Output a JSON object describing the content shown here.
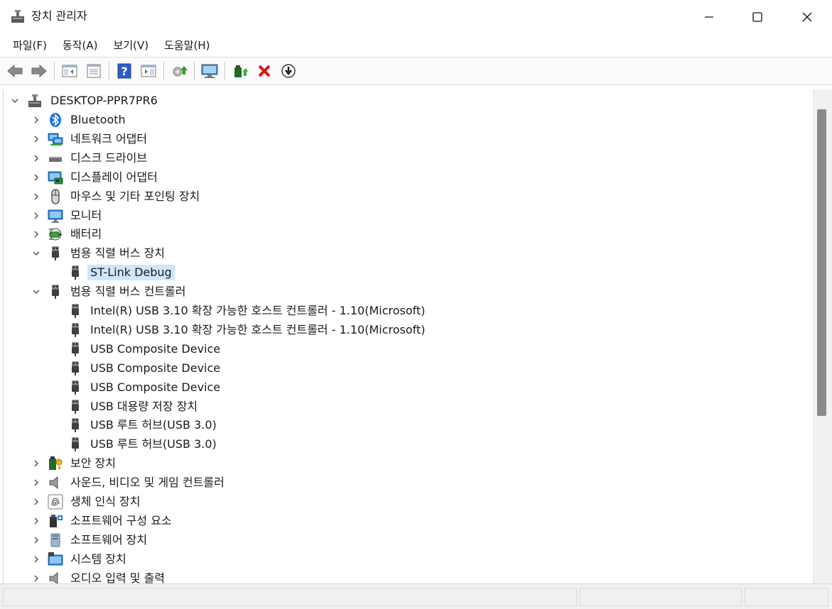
{
  "window": {
    "title": "장치 관리자",
    "minimize_icon": "minimize-icon",
    "maximize_icon": "maximize-icon",
    "close_icon": "close-icon"
  },
  "menu": [
    "파일(F)",
    "동작(A)",
    "보기(V)",
    "도움말(H)"
  ],
  "toolbar": {
    "buttons": [
      "back-arrow-icon",
      "forward-arrow-icon",
      "show-hide-console-tree-icon",
      "properties-icon",
      "help-icon",
      "action-pane-icon",
      "update-driver-icon",
      "scan-hardware-icon",
      "enable-device-icon",
      "uninstall-device-icon",
      "disable-device-icon"
    ]
  },
  "tree": {
    "root": "DESKTOP-PPR7PR6",
    "rows": [
      {
        "label": "Bluetooth",
        "icon": "bluetooth-icon",
        "level": 1,
        "expanded": false
      },
      {
        "label": "네트워크 어댑터",
        "icon": "network-adapter-icon",
        "level": 1,
        "expanded": false
      },
      {
        "label": "디스크 드라이브",
        "icon": "disk-drive-icon",
        "level": 1,
        "expanded": false
      },
      {
        "label": "디스플레이 어댑터",
        "icon": "display-adapter-icon",
        "level": 1,
        "expanded": false
      },
      {
        "label": "마우스 및 기타 포인팅 장치",
        "icon": "mouse-icon",
        "level": 1,
        "expanded": false
      },
      {
        "label": "모니터",
        "icon": "monitor-icon",
        "level": 1,
        "expanded": false
      },
      {
        "label": "배터리",
        "icon": "battery-icon",
        "level": 1,
        "expanded": false
      },
      {
        "label": "범용 직렬 버스 장치",
        "icon": "usb-plug-icon",
        "level": 1,
        "expanded": true
      },
      {
        "label": "ST-Link Debug",
        "icon": "usb-plug-icon",
        "level": 2,
        "selected": true
      },
      {
        "label": "범용 직렬 버스 컨트롤러",
        "icon": "usb-plug-icon",
        "level": 1,
        "expanded": true
      },
      {
        "label": "Intel(R) USB 3.10 확장 가능한 호스트 컨트롤러 - 1.10(Microsoft)",
        "icon": "usb-plug-icon",
        "level": 2
      },
      {
        "label": "Intel(R) USB 3.10 확장 가능한 호스트 컨트롤러 - 1.10(Microsoft)",
        "icon": "usb-plug-icon",
        "level": 2
      },
      {
        "label": "USB Composite Device",
        "icon": "usb-plug-icon",
        "level": 2
      },
      {
        "label": "USB Composite Device",
        "icon": "usb-plug-icon",
        "level": 2
      },
      {
        "label": "USB Composite Device",
        "icon": "usb-plug-icon",
        "level": 2
      },
      {
        "label": "USB 대용량 저장 장치",
        "icon": "usb-plug-icon",
        "level": 2
      },
      {
        "label": "USB 루트 허브(USB 3.0)",
        "icon": "usb-plug-icon",
        "level": 2
      },
      {
        "label": "USB 루트 허브(USB 3.0)",
        "icon": "usb-plug-icon",
        "level": 2
      },
      {
        "label": "보안 장치",
        "icon": "security-device-icon",
        "level": 1,
        "expanded": false
      },
      {
        "label": "사운드, 비디오 및 게임 컨트롤러",
        "icon": "speaker-icon",
        "level": 1,
        "expanded": false
      },
      {
        "label": "생체 인식 장치",
        "icon": "fingerprint-icon",
        "level": 1,
        "expanded": false
      },
      {
        "label": "소프트웨어 구성 요소",
        "icon": "software-component-icon",
        "level": 1,
        "expanded": false
      },
      {
        "label": "소프트웨어 장치",
        "icon": "software-device-icon",
        "level": 1,
        "expanded": false
      },
      {
        "label": "시스템 장치",
        "icon": "system-device-icon",
        "level": 1,
        "expanded": false
      },
      {
        "label": "오디오 입력 및 출력",
        "icon": "audio-io-icon",
        "level": 1,
        "expanded": false
      }
    ]
  }
}
